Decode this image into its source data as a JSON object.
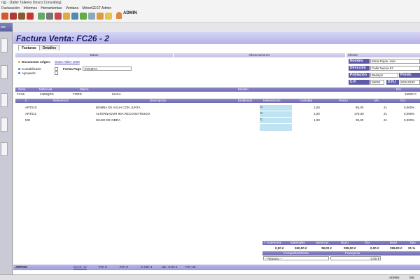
{
  "window": {
    "title": "ng) - [Taller Talleres Deyco Consulting]"
  },
  "menu": [
    "Facturación",
    "Informes",
    "Herramientas",
    "Ventana",
    "MotorGEST Admin"
  ],
  "toolbar": {
    "user": "ADMIN"
  },
  "left_panel": {
    "header": "ms"
  },
  "invoice": {
    "title": "Factura Venta: FC26 - 2",
    "tabs": [
      "Facturas",
      "Detalles"
    ],
    "sections": {
      "datos": "Datos",
      "observaciones": "Observaciones",
      "cliente": "Cliente"
    },
    "documento_label": "Documento origen:",
    "documento_value": "Órden Taller 1008",
    "contabilizado_label": "Contabilizado:",
    "agrupado_label": "Agrupado:",
    "forma_pago_label": "Forma Pago",
    "forma_pago_value": "TARJETA"
  },
  "cliente": {
    "nombre_label": "Nombre",
    "nombre_value": "Mora Rojas, Iván",
    "direccion_label": "Dirección",
    "direccion_value": "Calle Nueva 67",
    "poblacion_label": "Población",
    "poblacion_value": "Badajoz",
    "provincia_label": "Provin",
    "cp_label": "C.P.",
    "cp_value": "06001",
    "dni_label": "D.N.I",
    "dni_value": "00112233"
  },
  "vehicle": {
    "headers": [
      "Serie",
      "Matrícula",
      "Marca",
      "Modelo",
      "Km."
    ],
    "serie": "FC26",
    "matricula": "2468QRS",
    "marca": "FORD",
    "modelo": "KUGA",
    "km": "15000 C"
  },
  "lines": {
    "headers": [
      "C.",
      "Referencia",
      "Descripción",
      "Empleado",
      "Intervencion",
      "Cantidad",
      "Precio",
      "IVA",
      "Dto."
    ],
    "rows": [
      {
        "ref": "ART010",
        "desc": "BOMBA DE AGUA CON JUNTA",
        "emp": "",
        "interv": "C",
        "cant": "1,00",
        "precio": "85,00",
        "iva": "21",
        "dto": "0,000%"
      },
      {
        "ref": "ART011",
        "desc": "ALTERNADOR 90A RECONSTRUIDO",
        "emp": "",
        "interv": "C",
        "cant": "1,00",
        "precio": "175,00",
        "iva": "21",
        "dto": "0,000%"
      },
      {
        "ref": "MO",
        "desc": "MANO DE OBRA",
        "emp": "",
        "interv": "C",
        "cant": "1,00",
        "precio": "39,00",
        "iva": "21",
        "dto": "0,000%"
      }
    ]
  },
  "totals": {
    "headers": [
      "T. Exteriores",
      "Materiales",
      "Servicios",
      "Bruto",
      "Dto.",
      "Base",
      "Tipo"
    ],
    "values": [
      "0,00 €",
      "260,00 €",
      "39,00 €",
      "299,00 €",
      "0,00 €",
      "299,00 €",
      "21 %"
    ],
    "compania_label": "Compañía/Cliente",
    "franquicia_label": "Franquicia",
    "compania_value": "-- Ninguno --",
    "franquicia_value": "0,00 €"
  },
  "status": {
    "ref": "ART010",
    "stock": "Stock: 12",
    "fr": "F.R: 0",
    "fd": "F.D: 0",
    "ctrl": "C.Ctrl: 1",
    "ub": "Ub.: 0-01-1",
    "pc": "P.C.:40"
  },
  "bottom": {
    "user": "ADMIN",
    "extra": "MS"
  }
}
